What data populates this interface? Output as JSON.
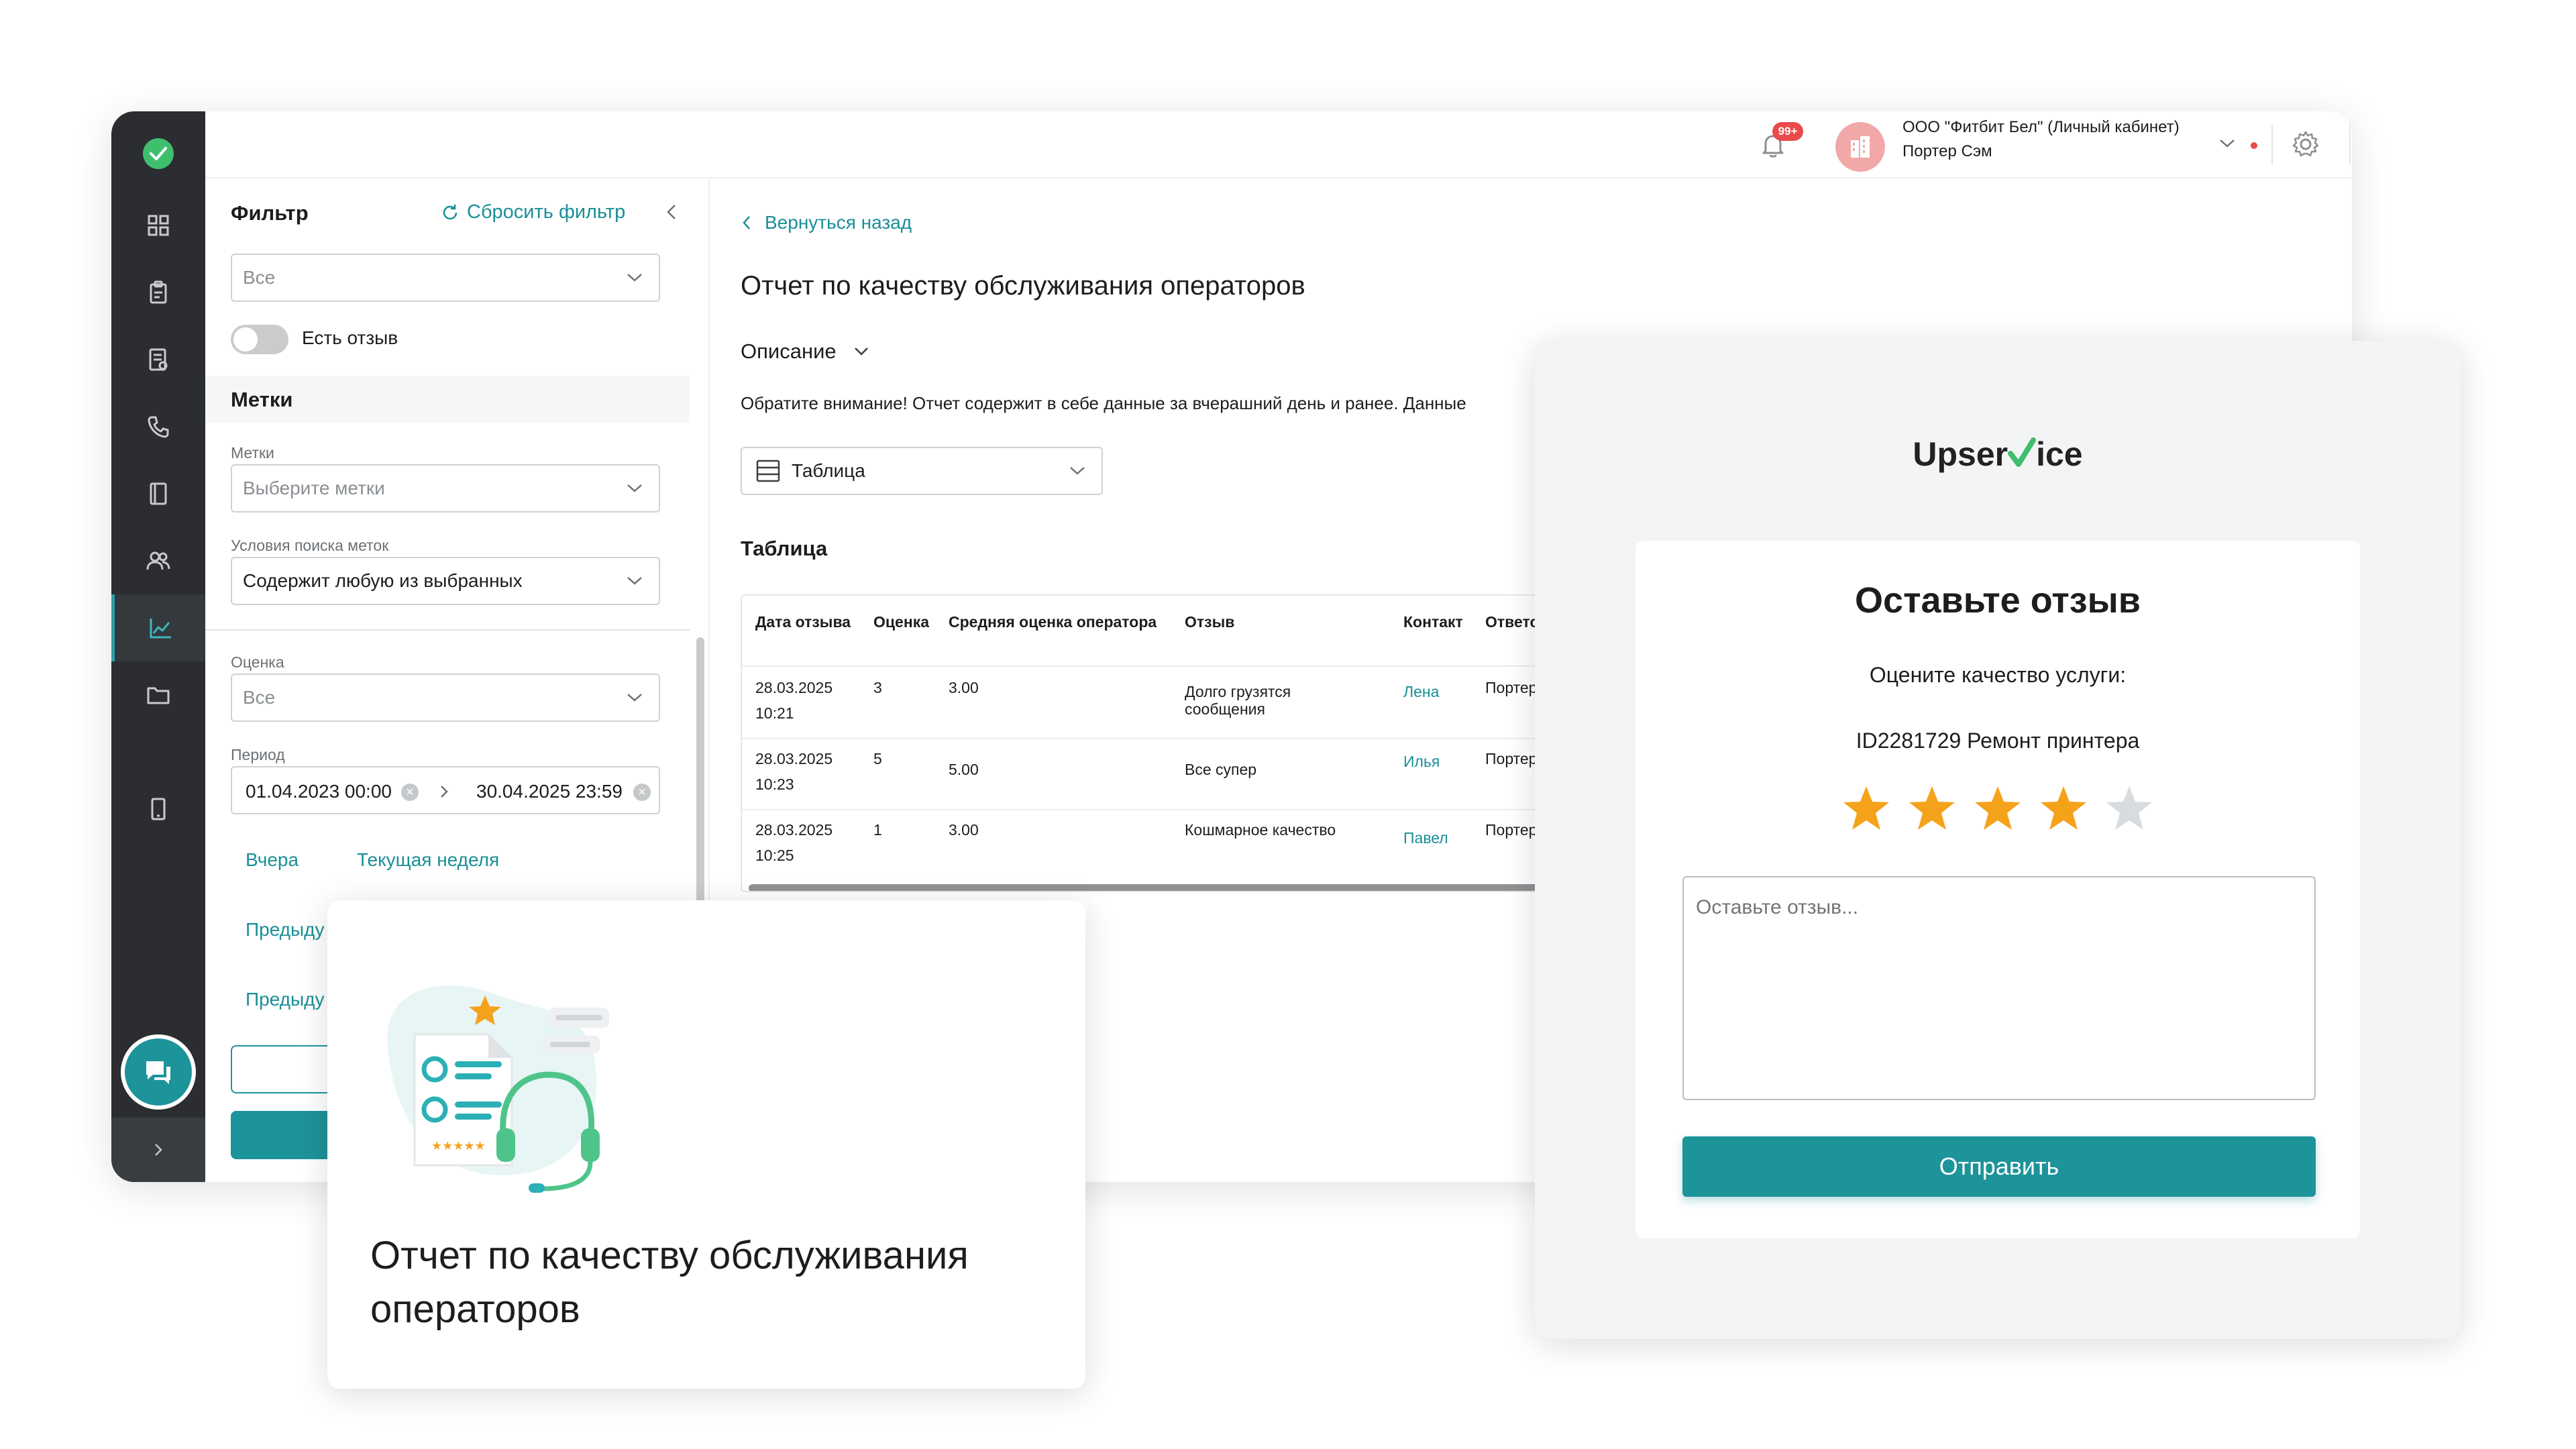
{
  "topbar": {
    "notif_badge": "99+",
    "org_name": "ООО \"Фитбит Бел\" (Личный кабинет)",
    "user_name": "Портер Сэм"
  },
  "filter": {
    "title": "Фильтр",
    "reset": "Сбросить фильтр",
    "status_value": "Все",
    "has_review_label": "Есть отзыв",
    "tags_section": "Метки",
    "tags_label": "Метки",
    "tags_placeholder": "Выберите метки",
    "tag_condition_label": "Условия поиска меток",
    "tag_condition_value": "Содержит любую из выбранных",
    "rating_label": "Оценка",
    "rating_value": "Все",
    "period_label": "Период",
    "period_from": "01.04.2023 00:00",
    "period_to": "30.04.2025 23:59",
    "quick_yesterday": "Вчера",
    "quick_week": "Текущая неделя",
    "quick_prev1": "Предыду",
    "quick_prev2": "Предыду"
  },
  "report": {
    "back": "Вернуться назад",
    "title": "Отчет по качеству обслуживания операторов",
    "description": "Описание",
    "notice": "Обратите внимание! Отчет содержит в себе данные за вчерашний день и ранее. Данные",
    "view_value": "Таблица",
    "table_title": "Таблица",
    "columns": [
      "Дата отзыва",
      "Оценка",
      "Средняя оценка оператора",
      "Отзыв",
      "Контакт",
      "Ответсте"
    ],
    "rows": [
      {
        "date": "28.03.2025",
        "time": "10:21",
        "rating": "3",
        "avg": "3.00",
        "review1": "Долго грузятся",
        "review2": "сообщения",
        "contact": "Лена",
        "resp": "Портер С"
      },
      {
        "date": "28.03.2025",
        "time": "10:23",
        "rating": "5",
        "avg": "5.00",
        "review1": "Все супер",
        "review2": "",
        "contact": "Илья",
        "resp": "Портер С"
      },
      {
        "date": "28.03.2025",
        "time": "10:25",
        "rating": "1",
        "avg": "3.00",
        "review1": "Кошмарное качество",
        "review2": "",
        "contact": "Павел",
        "resp": "Портер С"
      }
    ]
  },
  "card": {
    "title_line1": "Отчет по качеству обслуживания",
    "title_line2": "операторов"
  },
  "feedback": {
    "logo_pre": "Upser",
    "logo_post": "ice",
    "title": "Оставьте отзыв",
    "question": "Оцените качество услуги:",
    "ticket": "ID2281729 Ремонт принтера",
    "rating": 4,
    "rating_max": 5,
    "placeholder": "Оставьте отзыв...",
    "submit": "Отправить"
  },
  "colors": {
    "accent": "#1d939a",
    "star_on": "#f5a21b",
    "star_off": "#d9dcdf",
    "sidebar": "#2b2d30"
  }
}
